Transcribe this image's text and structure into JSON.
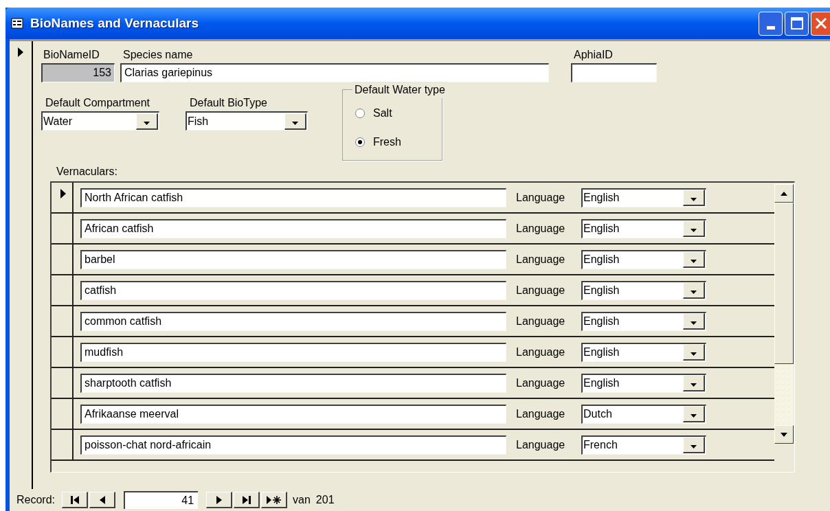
{
  "window": {
    "title": "BioNames and Vernaculars"
  },
  "record_marker": {
    "current": true
  },
  "fields": {
    "bionameid": {
      "label": "BioNameID",
      "value": "153",
      "locked": true
    },
    "species": {
      "label": "Species name",
      "value": "Clarias gariepinus"
    },
    "aphiaid": {
      "label": "AphiaID"
    }
  },
  "combos": [
    {
      "label": "Default Compartment",
      "value": "Water"
    },
    {
      "label": "Default BioType",
      "value": "Fish"
    }
  ],
  "water_type": {
    "title": "Default Water type",
    "options": [
      {
        "label": "Salt",
        "selected": false
      },
      {
        "label": "Fresh",
        "selected": true
      }
    ]
  },
  "vernaculars": {
    "label": "Vernaculars:",
    "rows": [
      {
        "name": "North African catfish",
        "language_label": "Language",
        "language": "English",
        "current": true
      },
      {
        "name": "African catfish",
        "language_label": "Language",
        "language": "English",
        "current": false
      },
      {
        "name": "barbel",
        "language_label": "Language",
        "language": "English",
        "current": false
      },
      {
        "name": "catfish",
        "language_label": "Language",
        "language": "English",
        "current": false
      },
      {
        "name": "common catfish",
        "language_label": "Language",
        "language": "English",
        "current": false
      },
      {
        "name": "mudfish",
        "language_label": "Language",
        "language": "English",
        "current": false
      },
      {
        "name": "sharptooth catfish",
        "language_label": "Language",
        "language": "English",
        "current": false
      },
      {
        "name": "Afrikaanse meerval",
        "language_label": "Language",
        "language": "Dutch",
        "current": false
      },
      {
        "name": "poisson-chat nord-africain",
        "language_label": "Language",
        "language": "French",
        "current": false
      }
    ]
  },
  "navigation": {
    "label": "Record:",
    "current": "41",
    "of_label": "van",
    "total": "201"
  }
}
